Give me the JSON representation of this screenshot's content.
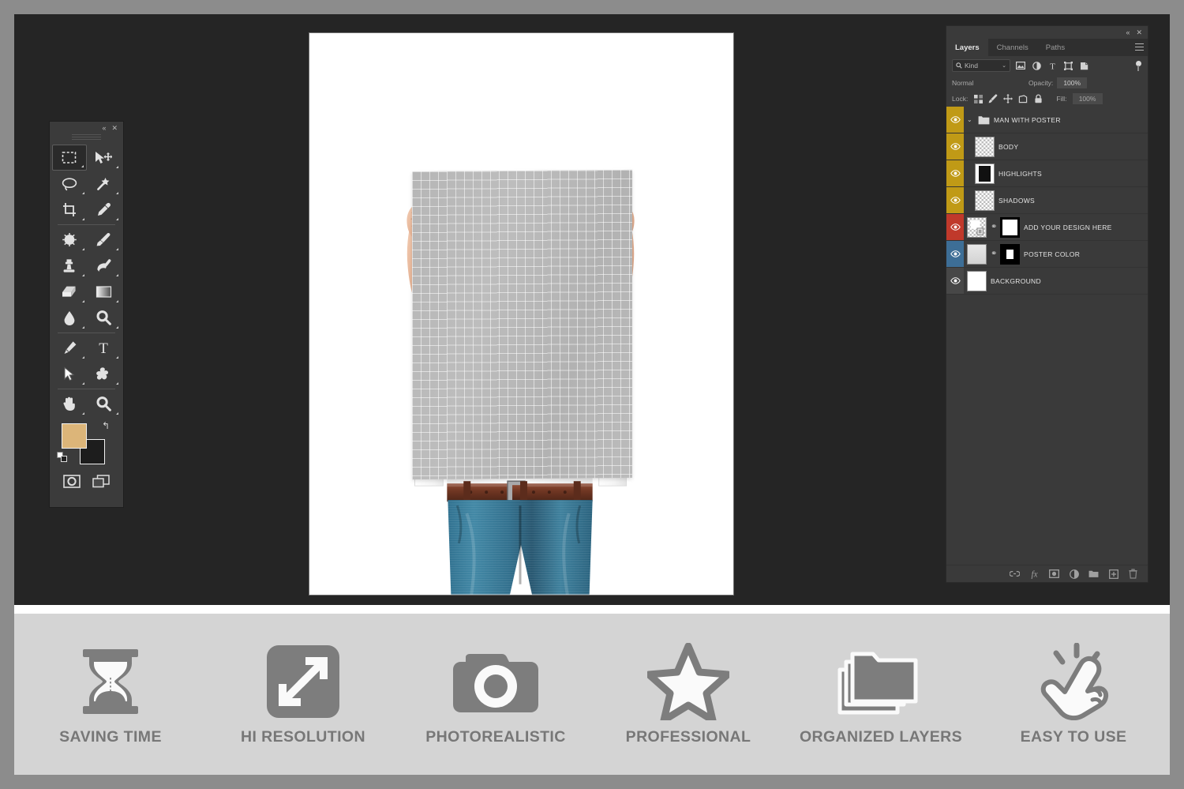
{
  "app": {
    "theme_accent": "#3a3a3a",
    "canvas_bg": "#252525",
    "outer_border": "#8c8c8c"
  },
  "toolbar": {
    "collapse_icon": "«",
    "close_icon": "✕",
    "tools": [
      {
        "name": "rectangular-marquee-tool",
        "active": true
      },
      {
        "name": "move-tool",
        "active": false
      },
      {
        "name": "lasso-tool",
        "active": false
      },
      {
        "name": "magic-wand-tool",
        "active": false
      },
      {
        "name": "crop-tool",
        "active": false
      },
      {
        "name": "eyedropper-tool",
        "active": false
      },
      {
        "name": "spot-healing-brush-tool",
        "active": false
      },
      {
        "name": "brush-tool",
        "active": false
      },
      {
        "name": "clone-stamp-tool",
        "active": false
      },
      {
        "name": "history-brush-tool",
        "active": false
      },
      {
        "name": "eraser-tool",
        "active": false
      },
      {
        "name": "gradient-tool",
        "active": false
      },
      {
        "name": "blur-tool",
        "active": false
      },
      {
        "name": "dodge-tool",
        "active": false
      },
      {
        "name": "pen-tool",
        "active": false
      },
      {
        "name": "type-tool",
        "active": false
      },
      {
        "name": "path-selection-tool",
        "active": false
      },
      {
        "name": "custom-shape-tool",
        "active": false
      },
      {
        "name": "hand-tool",
        "active": false
      },
      {
        "name": "zoom-tool",
        "active": false
      }
    ],
    "foreground_color": "#dcb579",
    "background_color": "#1d1d1d",
    "swap_icon": "↰",
    "mode_quickmask_name": "quick-mask-mode",
    "mode_screen_name": "screen-mode"
  },
  "layers_panel": {
    "collapse_icon": "«",
    "close_icon": "✕",
    "tabs": [
      {
        "label": "Layers",
        "active": true
      },
      {
        "label": "Channels",
        "active": false
      },
      {
        "label": "Paths",
        "active": false
      }
    ],
    "filter": {
      "kind_label": "Kind",
      "chevron": "⌄",
      "icons": [
        "pixel-filter-icon",
        "adjustment-filter-icon",
        "type-filter-icon",
        "shape-filter-icon",
        "smart-object-filter-icon"
      ]
    },
    "blend_mode": "Normal",
    "opacity_label": "Opacity:",
    "opacity_value": "100%",
    "lock_label": "Lock:",
    "fill_label": "Fill:",
    "fill_value": "100%",
    "layers": [
      {
        "name": "MAN WITH POSTER",
        "type": "group",
        "color": "#c09a16",
        "visible": true,
        "expanded": true,
        "indent": 0,
        "thumb": "none",
        "mask": "none",
        "linked": false
      },
      {
        "name": "BODY",
        "type": "pixel",
        "color": "#c09a16",
        "visible": true,
        "indent": 1,
        "thumb": "checker",
        "mask": "none",
        "linked": false
      },
      {
        "name": "HIGHLIGHTS",
        "type": "pixel",
        "color": "#c09a16",
        "visible": true,
        "indent": 1,
        "thumb": "blackbox",
        "mask": "none",
        "linked": false
      },
      {
        "name": "SHADOWS",
        "type": "pixel",
        "color": "#c09a16",
        "visible": true,
        "indent": 1,
        "thumb": "checker",
        "mask": "none",
        "linked": false
      },
      {
        "name": "ADD YOUR DESIGN HERE",
        "type": "smart-object",
        "color": "#c0392b",
        "visible": true,
        "indent": 0,
        "thumb": "smart",
        "mask": "white",
        "linked": true
      },
      {
        "name": "POSTER COLOR",
        "type": "pixel",
        "color": "#3d6e96",
        "visible": true,
        "indent": 0,
        "thumb": "solid-grey",
        "mask": "inverted",
        "linked": true
      },
      {
        "name": "BACKGROUND",
        "type": "pixel",
        "color": "#474747",
        "visible": true,
        "indent": 0,
        "thumb": "white",
        "mask": "none",
        "linked": false
      }
    ],
    "footer_icons": [
      "link-layers-icon",
      "layer-style-fx-icon",
      "add-layer-mask-icon",
      "new-adjustment-layer-icon",
      "new-group-icon",
      "new-layer-icon",
      "delete-layer-icon"
    ]
  },
  "artboard": {
    "subject": "man-holding-blank-poster",
    "poster_state": "empty-grid-placeholder"
  },
  "features": [
    {
      "label": "SAVING TIME",
      "icon": "hourglass-icon"
    },
    {
      "label": "HI RESOLUTION",
      "icon": "resize-arrows-icon"
    },
    {
      "label": "PHOTOREALISTIC",
      "icon": "camera-icon"
    },
    {
      "label": "PROFESSIONAL",
      "icon": "star-icon"
    },
    {
      "label": "ORGANIZED LAYERS",
      "icon": "stacked-folders-icon"
    },
    {
      "label": "EASY TO USE",
      "icon": "tap-hand-icon"
    }
  ]
}
